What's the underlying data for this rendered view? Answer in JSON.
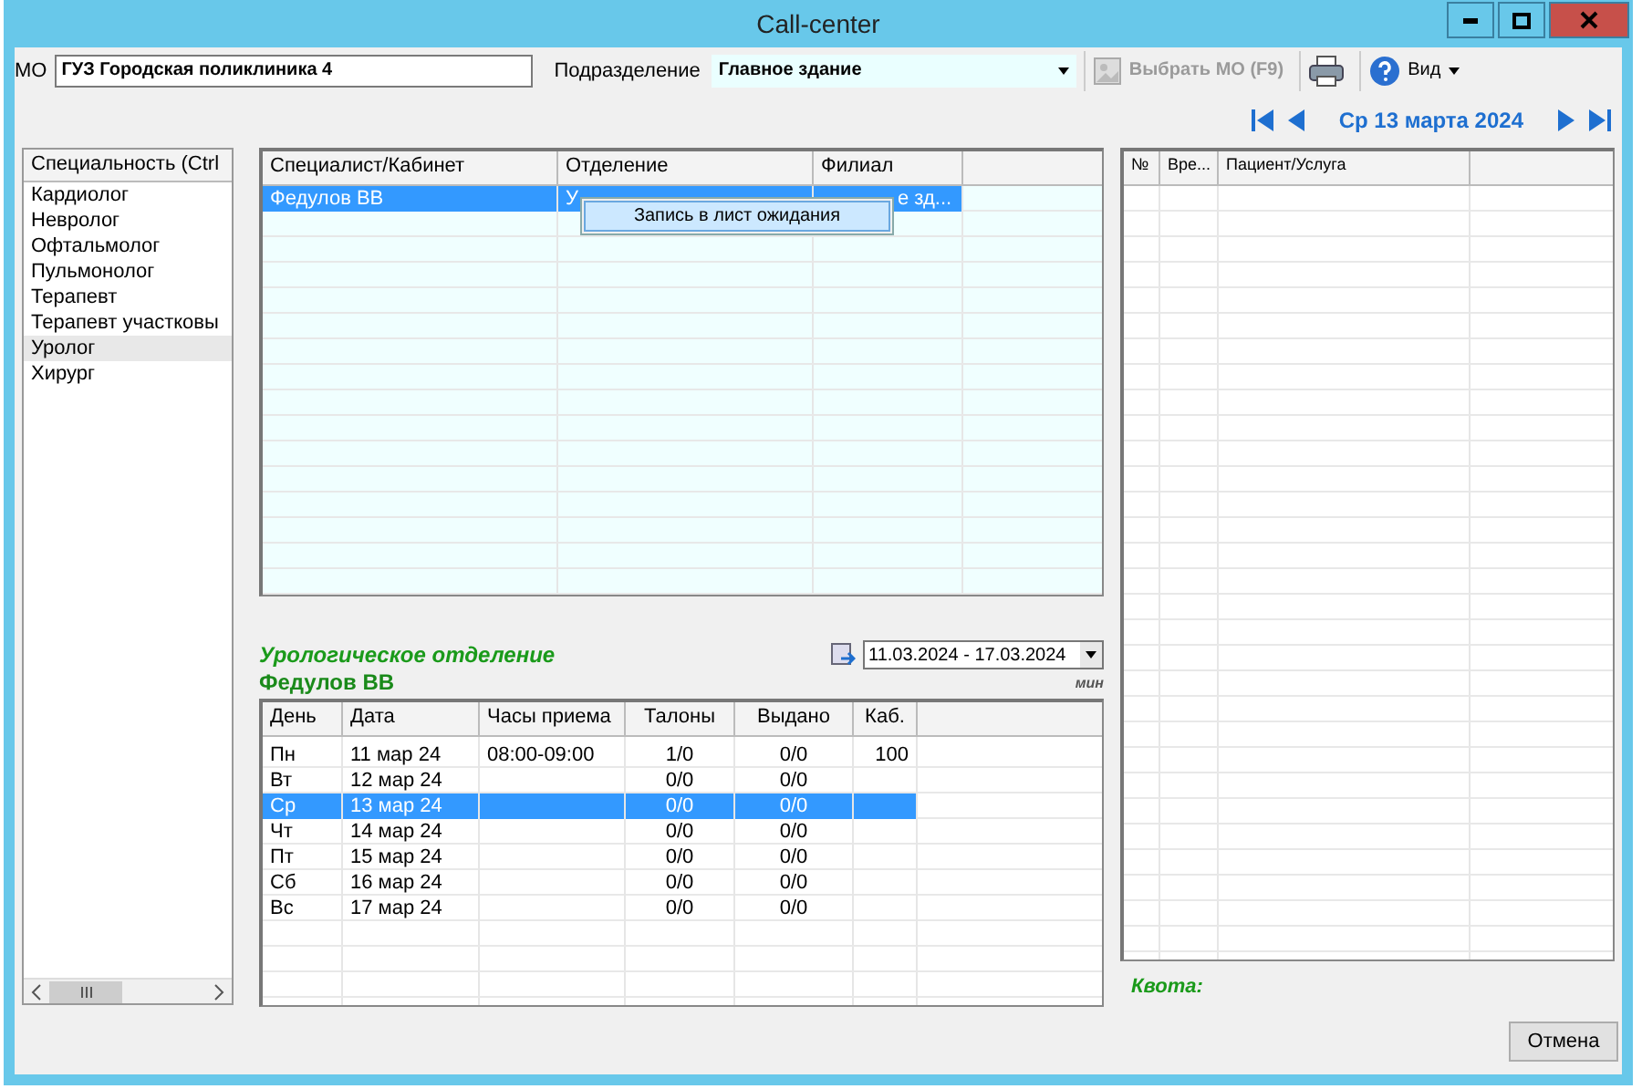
{
  "window": {
    "title": "Call-center"
  },
  "toolbar": {
    "mo_label": "МО",
    "mo_value": "ГУЗ Городская поликлиника 4",
    "division_label": "Подразделение",
    "division_value": "Главное здание",
    "select_mo_button": {
      "label": "Выбрать МО (F9)",
      "disabled": true
    },
    "view_menu": "Вид"
  },
  "date_nav": {
    "date": "Ср 13 марта 2024"
  },
  "specialties": {
    "header": "Специальность (Ctrl",
    "items": [
      {
        "label": "Кардиолог",
        "selected": false
      },
      {
        "label": "Невролог",
        "selected": false
      },
      {
        "label": "Офтальмолог",
        "selected": false
      },
      {
        "label": "Пульмонолог",
        "selected": false
      },
      {
        "label": "Терапевт",
        "selected": false
      },
      {
        "label": "Терапевт участковы",
        "selected": false
      },
      {
        "label": "Уролог",
        "selected": true
      },
      {
        "label": "Хирург",
        "selected": false
      }
    ]
  },
  "specialists": {
    "columns": [
      "Специалист/Кабинет",
      "Отделение",
      "Филиал"
    ],
    "rows": [
      {
        "cells": [
          "Федулов ВВ",
          "У",
          "е зд..."
        ],
        "selected": true
      }
    ]
  },
  "context_menu": {
    "items": [
      "Запись в лист ожидания"
    ]
  },
  "schedule": {
    "department": "Урологическое отделение",
    "doctor": "Федулов ВВ",
    "unit": "мин",
    "period": "11.03.2024 - 17.03.2024",
    "columns": [
      "День",
      "Дата",
      "Часы приема",
      "Талоны",
      "Выдано",
      "Каб."
    ],
    "rows": [
      {
        "cells": [
          "Пн",
          "11 мар 24",
          "08:00-09:00",
          "1/0",
          "0/0",
          "100"
        ],
        "selected": false
      },
      {
        "cells": [
          "Вт",
          "12 мар 24",
          "",
          "0/0",
          "0/0",
          ""
        ],
        "selected": false
      },
      {
        "cells": [
          "Ср",
          "13 мар 24",
          "",
          "0/0",
          "0/0",
          ""
        ],
        "selected": true
      },
      {
        "cells": [
          "Чт",
          "14 мар 24",
          "",
          "0/0",
          "0/0",
          ""
        ],
        "selected": false
      },
      {
        "cells": [
          "Пт",
          "15 мар 24",
          "",
          "0/0",
          "0/0",
          ""
        ],
        "selected": false
      },
      {
        "cells": [
          "Сб",
          "16 мар 24",
          "",
          "0/0",
          "0/0",
          ""
        ],
        "selected": false
      },
      {
        "cells": [
          "Вс",
          "17 мар 24",
          "",
          "0/0",
          "0/0",
          ""
        ],
        "selected": false
      }
    ]
  },
  "appointments": {
    "columns": [
      "№",
      "Вре...",
      "Пациент/Услуга"
    ]
  },
  "quota_label": "Квота:",
  "cancel_button": "Отмена"
}
